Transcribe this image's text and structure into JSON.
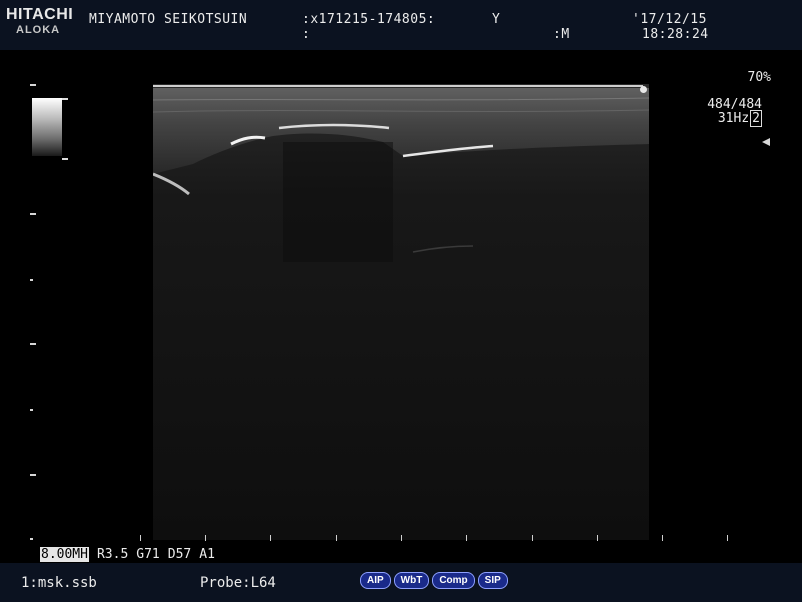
{
  "header": {
    "brand_top": "HITACHI",
    "brand_bottom": "ALOKA",
    "institution": "MIYAMOTO SEIKOTSUIN",
    "patient_id_label": ":x171215-174805:",
    "sex_label": "Y",
    "line2_colon": ":",
    "sex_m_label": ":M",
    "date": "'17/12/15",
    "time": "18:28:24"
  },
  "display": {
    "gain_percent": "70%",
    "line_density": "484/484",
    "frame_rate": "31Hz",
    "frame_rate_mode": "2"
  },
  "params": {
    "frequency": "8.00MH",
    "r": "R3.5",
    "g": "G71",
    "d": "D57",
    "a": "A1"
  },
  "footer": {
    "preset": "1:msk.ssb",
    "probe": "Probe:L64",
    "buttons": [
      "AIP",
      "WbT",
      "Comp",
      "SIP"
    ]
  },
  "colors": {
    "background": "#000000",
    "header_footer_bg": "#0b1220",
    "button_fill": "#1a2a8a",
    "button_border": "#8ea0ff"
  }
}
